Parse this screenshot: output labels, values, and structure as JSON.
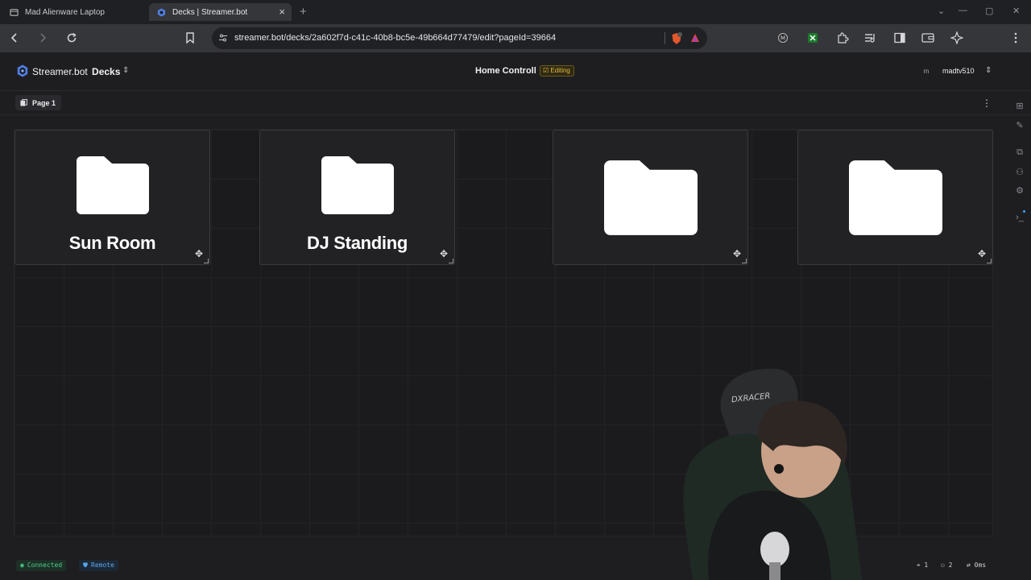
{
  "browser": {
    "tabs": [
      {
        "title": "Mad Alienware Laptop"
      },
      {
        "title": "Decks | Streamer.bot"
      }
    ],
    "url": "streamer.bot/decks/2a602f7d-c41c-40b8-bc5e-49b664d77479/edit?pageId=39664",
    "brave_shield_count": "1"
  },
  "app": {
    "brand": "Streamer.bot",
    "section": "Decks",
    "deck_title": "Home Controll",
    "status_badge": "Editing",
    "user_initial": "m",
    "user_name": "madtv510",
    "page_label": "Page 1"
  },
  "buttons": [
    {
      "label": "Sun Room",
      "icon": "folder-icon"
    },
    {
      "label": "DJ Standing",
      "icon": "folder-icon"
    },
    {
      "label": "",
      "icon": "folder-icon"
    },
    {
      "label": "",
      "icon": "folder-icon"
    }
  ],
  "footer": {
    "connected": "Connected",
    "remote": "Remote",
    "stat_a": "1",
    "stat_b": "2",
    "stat_c": "0ms"
  },
  "colors": {
    "accent_editing": "#e6b93c",
    "connected": "#4fd08a",
    "remote": "#59a7f0"
  }
}
